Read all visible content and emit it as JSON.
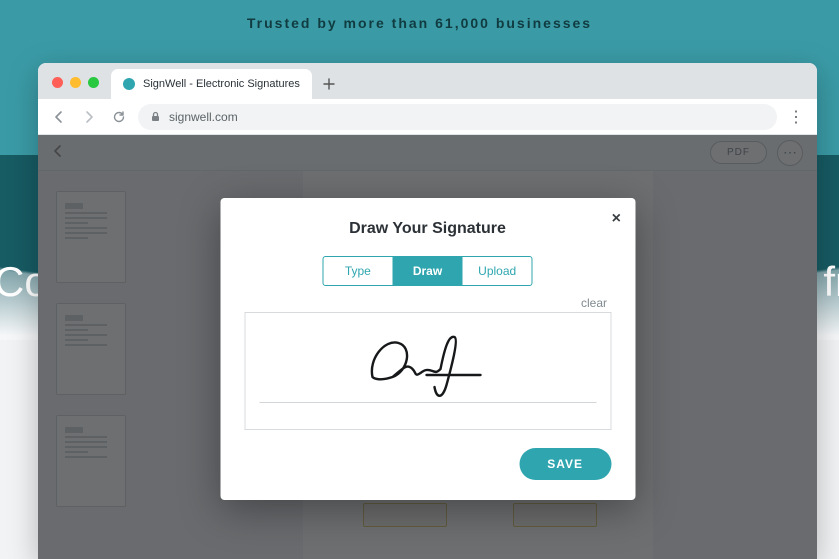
{
  "hero": {
    "trusted_text": "Trusted by more than 61,000 businesses",
    "bg_left_fragment": "Con",
    "bg_right_fragment": "t fr"
  },
  "browser": {
    "tab_title": "SignWell - Electronic Signatures",
    "url": "signwell.com"
  },
  "app_toolbar": {
    "pdf_label": "PDF"
  },
  "modal": {
    "title": "Draw Your Signature",
    "tabs": {
      "type": "Type",
      "draw": "Draw",
      "upload": "Upload"
    },
    "active_tab": "draw",
    "clear_label": "clear",
    "save_label": "SAVE"
  }
}
